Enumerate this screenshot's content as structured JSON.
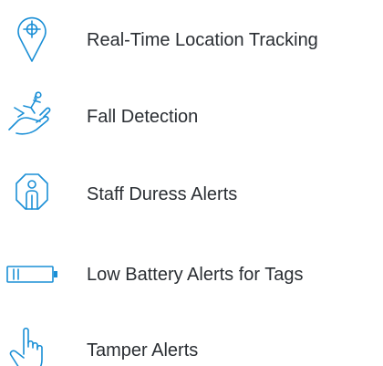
{
  "colors": {
    "icon": "#1a8fd6",
    "text": "#2a2e33"
  },
  "features": [
    {
      "label": "Real-Time Location Tracking",
      "icon": "location-pin-icon"
    },
    {
      "label": "Fall Detection",
      "icon": "falling-person-hand-icon"
    },
    {
      "label": "Staff Duress Alerts",
      "icon": "staff-badge-icon"
    },
    {
      "label": "Low Battery Alerts for Tags",
      "icon": "low-battery-icon"
    },
    {
      "label": "Tamper Alerts",
      "icon": "touch-hand-icon"
    }
  ]
}
